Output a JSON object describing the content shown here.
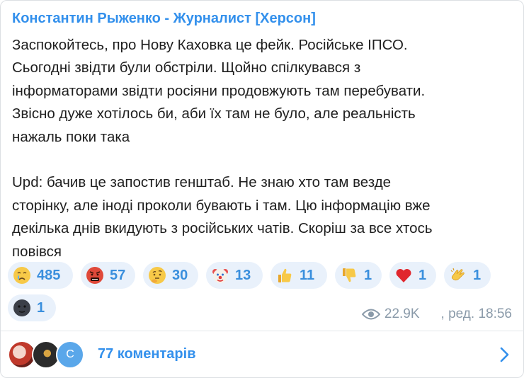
{
  "post": {
    "author": "Константин Рыженко - Журналист [Херсон]",
    "lines": [
      "Заспокойтесь, про Нову Каховка це фейк. Російське ІПСО.",
      "Сьогодні звідти були обстріли. Щойно спілкувався з",
      "інформаторами звідти росіяни продовжують там перебувати.",
      "Звісно дуже хотілось би, аби їх там не було, але реальність",
      "нажаль поки така",
      "",
      "Upd: бачив це запостив генштаб. Не знаю хто там везде",
      "сторінку, але іноді проколи бувають і там. Цю інформацію вже",
      "декілька днів вкидують з російських чатів. Скоріш за все хтось",
      "повівся"
    ]
  },
  "reactions": [
    {
      "icon": "crying-face-icon",
      "count": "485"
    },
    {
      "icon": "angry-cursing-face-icon",
      "count": "57"
    },
    {
      "icon": "thinking-face-icon",
      "count": "30"
    },
    {
      "icon": "clown-face-icon",
      "count": "13"
    },
    {
      "icon": "thumbs-up-icon",
      "count": "11"
    },
    {
      "icon": "thumbs-down-icon",
      "count": "1"
    },
    {
      "icon": "red-heart-icon",
      "count": "1"
    },
    {
      "icon": "clapping-hands-icon",
      "count": "1"
    },
    {
      "icon": "new-moon-face-icon",
      "count": "1"
    }
  ],
  "meta": {
    "views": "22.9K",
    "edited": ", ред. 18:56"
  },
  "comments": {
    "label": "77 коментарів",
    "avatar_initial": "C"
  },
  "colors": {
    "accent": "#3390ec",
    "reaction_bg": "#e9f1fb",
    "meta": "#8a9aa9"
  }
}
